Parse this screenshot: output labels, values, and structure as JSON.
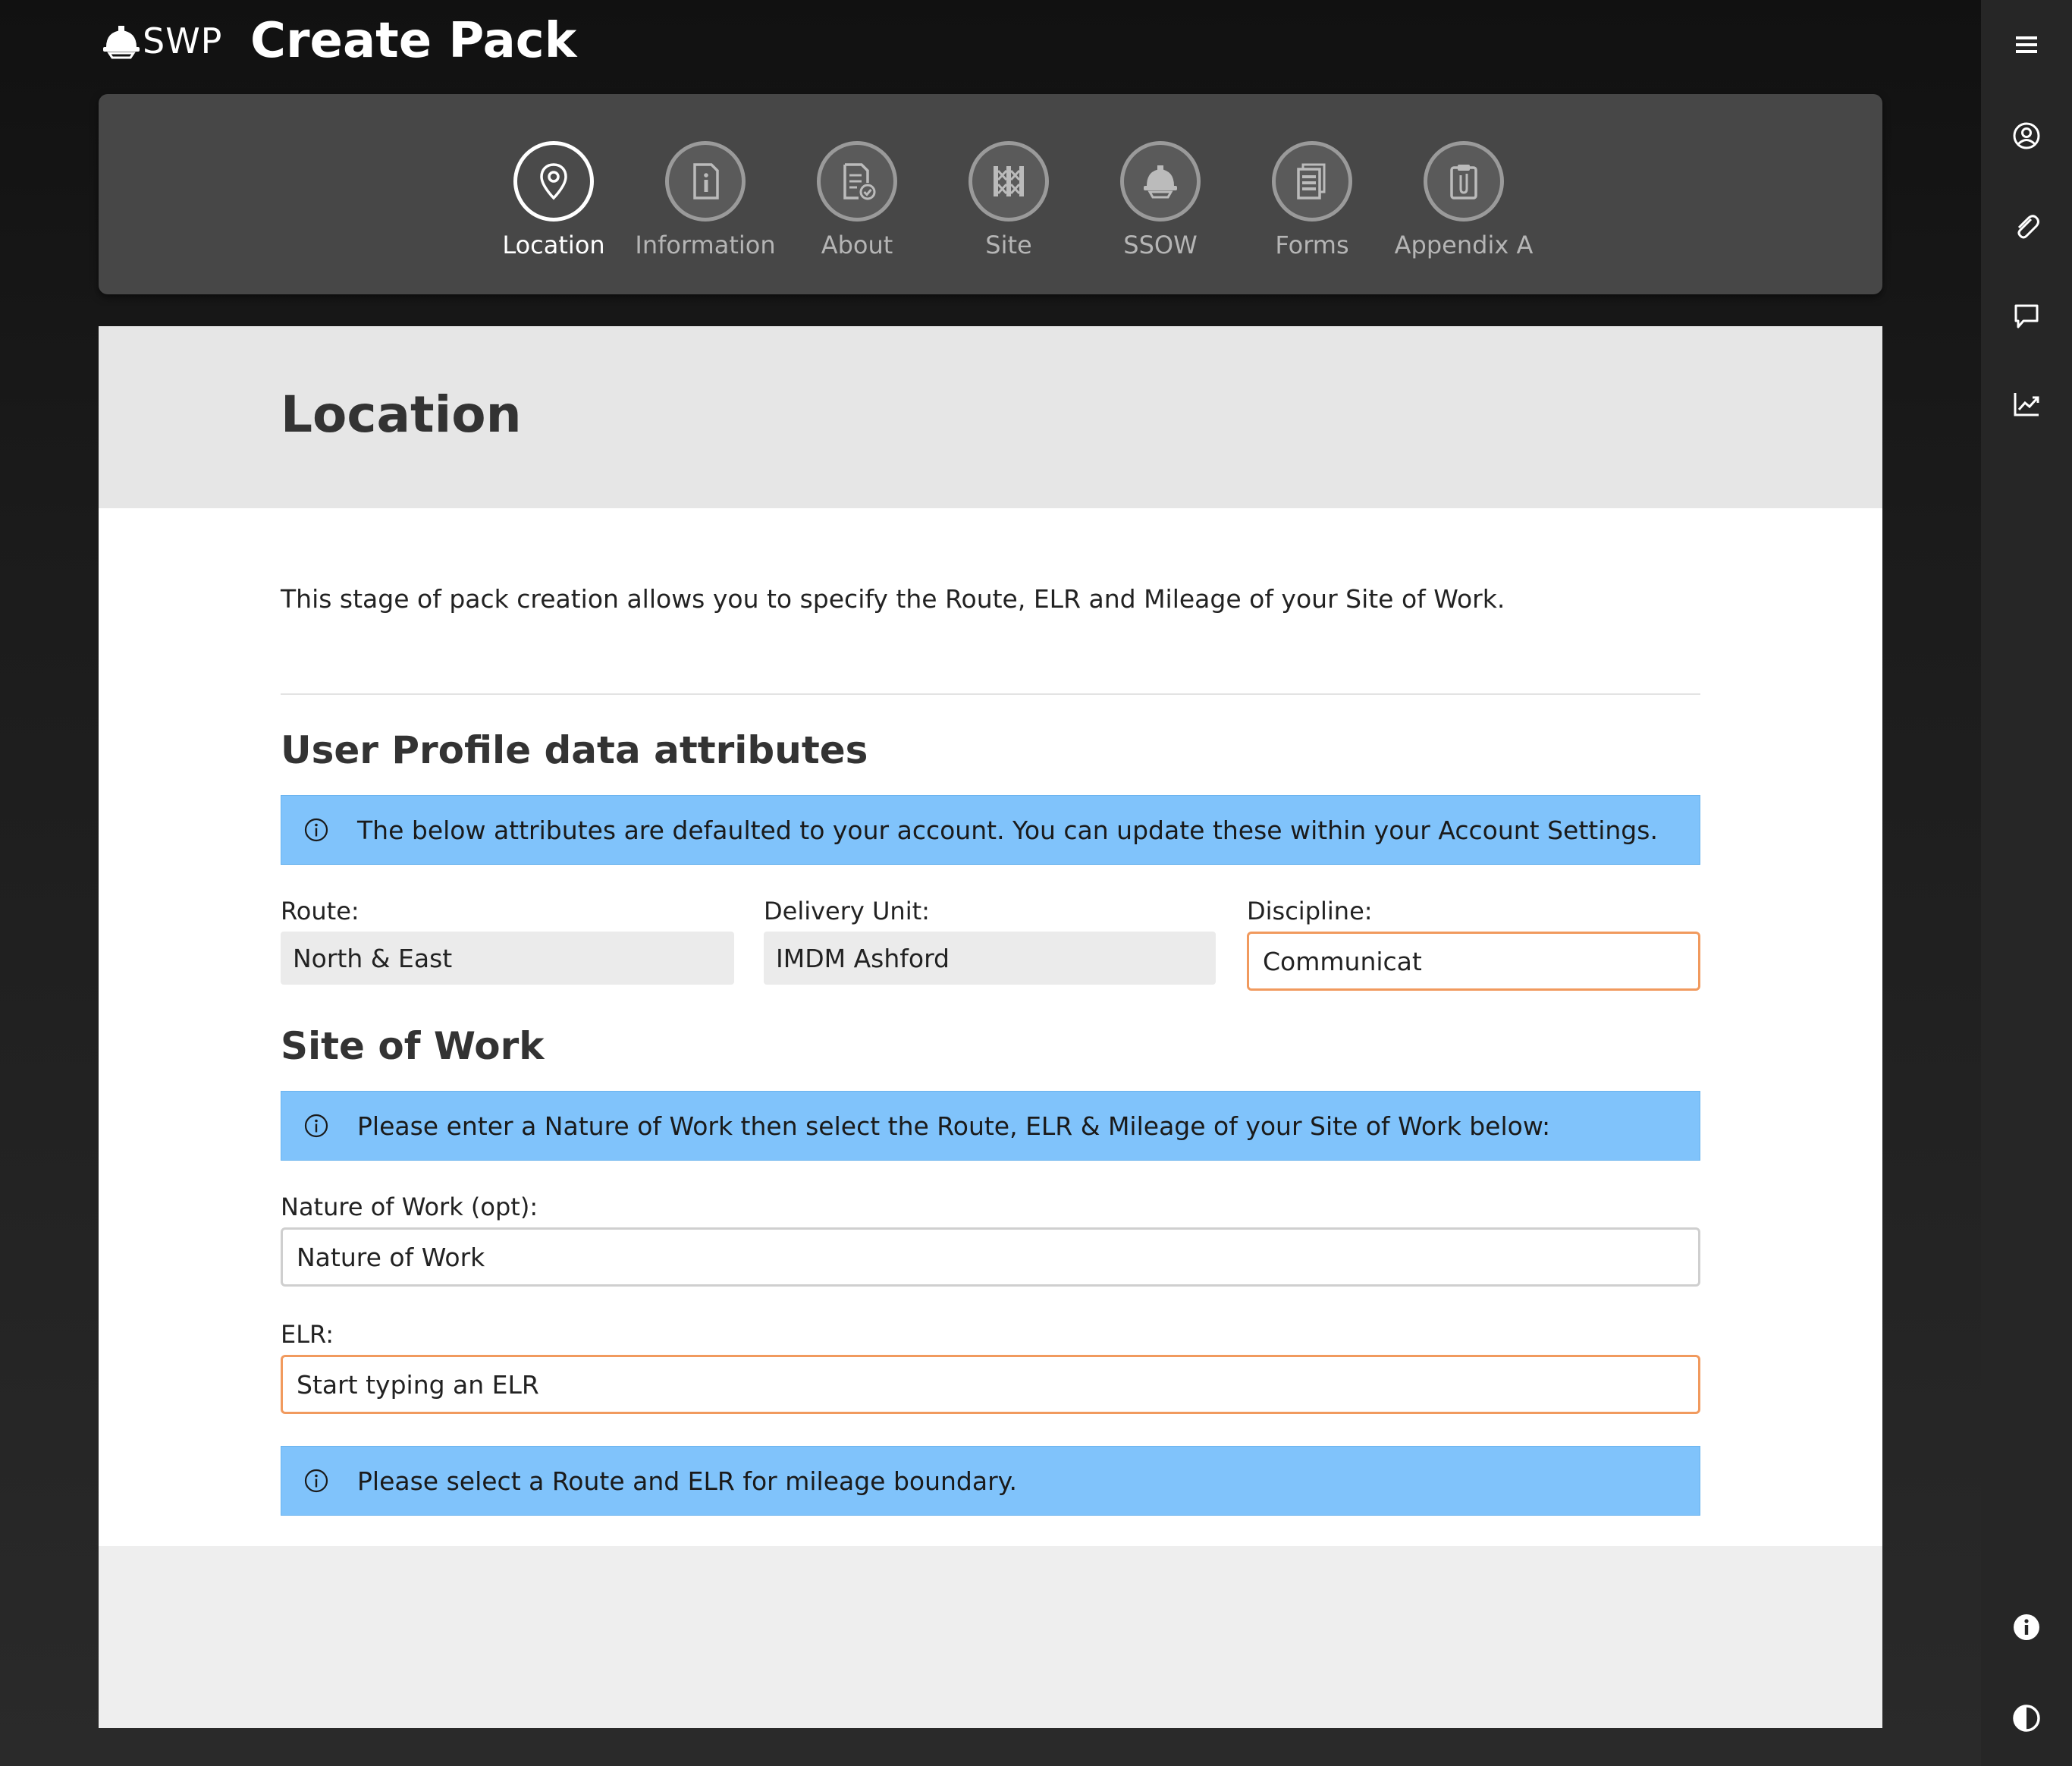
{
  "header": {
    "logo_text": "SWP",
    "title": "Create Pack"
  },
  "stepper": {
    "steps": [
      {
        "label": "Location",
        "icon": "map-pin-icon",
        "active": true
      },
      {
        "label": "Information",
        "icon": "info-document-icon",
        "active": false
      },
      {
        "label": "About",
        "icon": "document-check-icon",
        "active": false
      },
      {
        "label": "Site",
        "icon": "site-barrier-icon",
        "active": false
      },
      {
        "label": "SSOW",
        "icon": "hard-hat-icon",
        "active": false
      },
      {
        "label": "Forms",
        "icon": "forms-icon",
        "active": false
      },
      {
        "label": "Appendix A",
        "icon": "clipboard-paperclip-icon",
        "active": false
      }
    ]
  },
  "page": {
    "title": "Location",
    "intro": "This stage of pack creation allows you to specify the Route, ELR and Mileage of your Site of Work."
  },
  "profile": {
    "title": "User Profile data attributes",
    "alert": "The below attributes are defaulted to your account. You can update these within your Account Settings.",
    "route_label": "Route:",
    "route_value": "North & East",
    "delivery_label": "Delivery Unit:",
    "delivery_value": "IMDM Ashford",
    "discipline_label": "Discipline:",
    "discipline_value": "Communicat"
  },
  "site": {
    "title": "Site of Work",
    "alert": "Please enter a Nature of Work then select the Route, ELR & Mileage of your Site of Work below:",
    "nature_label": "Nature of Work (opt):",
    "nature_placeholder": "Nature of Work",
    "elr_label": "ELR:",
    "elr_placeholder": "Start typing an ELR",
    "mileage_alert": "Please select a Route and ELR for mileage boundary."
  },
  "rail": {
    "icons": [
      "menu-icon",
      "user-circle-icon",
      "paperclip-icon",
      "comment-icon",
      "chart-line-icon",
      "info-circle-icon",
      "contrast-icon"
    ]
  },
  "colors": {
    "alert_bg": "#80c3fb",
    "invalid_border": "#f19a5e",
    "stepper_bg": "#474747"
  }
}
